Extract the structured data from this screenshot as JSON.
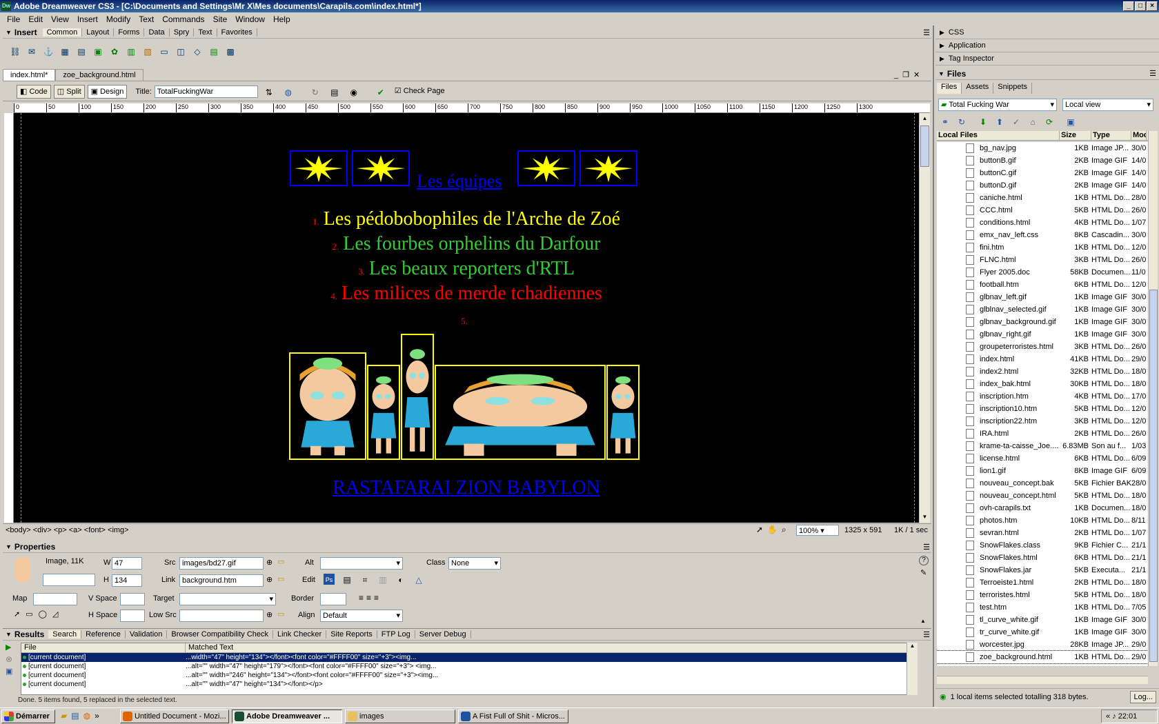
{
  "window": {
    "title": "Adobe Dreamweaver CS3 - [C:\\Documents and Settings\\Mr X\\Mes documents\\Carapils.com\\index.html*]",
    "logo": "Dw"
  },
  "menu": [
    "File",
    "Edit",
    "View",
    "Insert",
    "Modify",
    "Text",
    "Commands",
    "Site",
    "Window",
    "Help"
  ],
  "insert": {
    "title": "Insert",
    "tabs": [
      "Common",
      "Layout",
      "Forms",
      "Data",
      "Spry",
      "Text",
      "Favorites"
    ]
  },
  "doc_tabs": [
    "index.html*",
    "zoe_background.html"
  ],
  "doc_toolbar": {
    "code": "Code",
    "split": "Split",
    "design": "Design",
    "title_label": "Title:",
    "title_value": "TotalFuckingWar",
    "check_page": "Check Page"
  },
  "ruler_ticks": [
    "0",
    "50",
    "100",
    "150",
    "200",
    "250",
    "300",
    "350",
    "400",
    "450",
    "500",
    "550",
    "600",
    "650",
    "700",
    "750",
    "800",
    "850",
    "900",
    "950",
    "1000",
    "1050",
    "1100",
    "1150",
    "1200",
    "1250",
    "1300"
  ],
  "page": {
    "heading_link": "Les équipes",
    "list": [
      {
        "num": "1.",
        "text": "Les pédobobophiles de l'Arche de Zoé",
        "color": "#ffff00"
      },
      {
        "num": "2.",
        "text": "Les fourbes orphelins du Darfour",
        "color": "#33cc33"
      },
      {
        "num": "3.",
        "text": "Les beaux reporters d'RTL",
        "color": "#33cc33"
      },
      {
        "num": "4.",
        "text": "Les milices de merde tchadiennes",
        "color": "#ff0000"
      },
      {
        "num": "5.",
        "text": "",
        "color": "#ff0000"
      }
    ],
    "footer_link": "RASTAFARAI ZION BABYLON"
  },
  "status": {
    "tags": "<body> <div> <p> <a> <font> <img>",
    "zoom": "100%",
    "size": "1325 x 591",
    "download": "1K / 1 sec"
  },
  "properties": {
    "title": "Properties",
    "kind": "Image, 11K",
    "w_label": "W",
    "w": "47",
    "h_label": "H",
    "h": "134",
    "src_label": "Src",
    "src": "images/bd27.gif",
    "link_label": "Link",
    "link": "background.htm",
    "alt_label": "Alt",
    "alt": "",
    "class_label": "Class",
    "class": "None",
    "edit_label": "Edit",
    "map_label": "Map",
    "vspace_label": "V Space",
    "target_label": "Target",
    "border_label": "Border",
    "hspace_label": "H Space",
    "lowsrc_label": "Low Src",
    "align_label": "Align",
    "align": "Default"
  },
  "results": {
    "title": "Results",
    "tabs": [
      "Search",
      "Reference",
      "Validation",
      "Browser Compatibility Check",
      "Link Checker",
      "Site Reports",
      "FTP Log",
      "Server Debug"
    ],
    "col_file": "File",
    "col_match": "Matched Text",
    "rows": [
      {
        "file": "[current document]",
        "match": "...width=\"47\" height=\"134\"></font><font color=\"#FFFF00\" size=\"+3\"><img..."
      },
      {
        "file": "[current document]",
        "match": "...alt=\"\" width=\"47\" height=\"179\"></font><font color=\"#FFFF00\" size=\"+3\"> <img..."
      },
      {
        "file": "[current document]",
        "match": "...alt=\"\" width=\"246\" height=\"134\"></font><font color=\"#FFFF00\" size=\"+3\"><img..."
      },
      {
        "file": "[current document]",
        "match": "...alt=\"\" width=\"47\" height=\"134\"></font></p>"
      }
    ],
    "status": "Done. 5 items found, 5 replaced in the selected text."
  },
  "right_panels": [
    "CSS",
    "Application",
    "Tag Inspector"
  ],
  "files": {
    "title": "Files",
    "tabs": [
      "Files",
      "Assets",
      "Snippets"
    ],
    "site": "Total Fucking War",
    "view": "Local view",
    "cols": [
      "Local Files",
      "Size",
      "Type",
      "Mod"
    ],
    "items": [
      {
        "name": "bg_nav.jpg",
        "size": "1KB",
        "type": "Image JP...",
        "mod": "30/0"
      },
      {
        "name": "buttonB.gif",
        "size": "2KB",
        "type": "Image GIF",
        "mod": "14/0"
      },
      {
        "name": "buttonC.gif",
        "size": "2KB",
        "type": "Image GIF",
        "mod": "14/0"
      },
      {
        "name": "buttonD.gif",
        "size": "2KB",
        "type": "Image GIF",
        "mod": "14/0"
      },
      {
        "name": "caniche.html",
        "size": "1KB",
        "type": "HTML Do...",
        "mod": "28/0"
      },
      {
        "name": "CCC.html",
        "size": "5KB",
        "type": "HTML Do...",
        "mod": "26/0"
      },
      {
        "name": "conditions.html",
        "size": "4KB",
        "type": "HTML Do...",
        "mod": "1/07"
      },
      {
        "name": "emx_nav_left.css",
        "size": "8KB",
        "type": "Cascadin...",
        "mod": "30/0"
      },
      {
        "name": "fini.htm",
        "size": "1KB",
        "type": "HTML Do...",
        "mod": "12/0"
      },
      {
        "name": "FLNC.html",
        "size": "3KB",
        "type": "HTML Do...",
        "mod": "26/0"
      },
      {
        "name": "Flyer 2005.doc",
        "size": "58KB",
        "type": "Documen...",
        "mod": "11/0"
      },
      {
        "name": "football.htm",
        "size": "6KB",
        "type": "HTML Do...",
        "mod": "12/0"
      },
      {
        "name": "glbnav_left.gif",
        "size": "1KB",
        "type": "Image GIF",
        "mod": "30/0"
      },
      {
        "name": "glblnav_selected.gif",
        "size": "1KB",
        "type": "Image GIF",
        "mod": "30/0"
      },
      {
        "name": "glbnav_background.gif",
        "size": "1KB",
        "type": "Image GIF",
        "mod": "30/0"
      },
      {
        "name": "glbnav_right.gif",
        "size": "1KB",
        "type": "Image GIF",
        "mod": "30/0"
      },
      {
        "name": "groupeterroristes.html",
        "size": "3KB",
        "type": "HTML Do...",
        "mod": "26/0"
      },
      {
        "name": "index.html",
        "size": "41KB",
        "type": "HTML Do...",
        "mod": "29/0"
      },
      {
        "name": "index2.html",
        "size": "32KB",
        "type": "HTML Do...",
        "mod": "18/0"
      },
      {
        "name": "index_bak.html",
        "size": "30KB",
        "type": "HTML Do...",
        "mod": "18/0"
      },
      {
        "name": "inscription.htm",
        "size": "4KB",
        "type": "HTML Do...",
        "mod": "17/0"
      },
      {
        "name": "inscription10.htm",
        "size": "5KB",
        "type": "HTML Do...",
        "mod": "12/0"
      },
      {
        "name": "inscription22.htm",
        "size": "3KB",
        "type": "HTML Do...",
        "mod": "12/0"
      },
      {
        "name": "IRA.html",
        "size": "2KB",
        "type": "HTML Do...",
        "mod": "26/0"
      },
      {
        "name": "krame-ta-caisse_Joe....",
        "size": "6.83MB",
        "type": "Son au f...",
        "mod": "1/03"
      },
      {
        "name": "license.html",
        "size": "6KB",
        "type": "HTML Do...",
        "mod": "6/09"
      },
      {
        "name": "lion1.gif",
        "size": "8KB",
        "type": "Image GIF",
        "mod": "6/09"
      },
      {
        "name": "nouveau_concept.bak",
        "size": "5KB",
        "type": "Fichier BAK",
        "mod": "28/0"
      },
      {
        "name": "nouveau_concept.html",
        "size": "5KB",
        "type": "HTML Do...",
        "mod": "18/0"
      },
      {
        "name": "ovh-carapils.txt",
        "size": "1KB",
        "type": "Documen...",
        "mod": "18/0"
      },
      {
        "name": "photos.htm",
        "size": "10KB",
        "type": "HTML Do...",
        "mod": "8/11"
      },
      {
        "name": "sevran.html",
        "size": "2KB",
        "type": "HTML Do...",
        "mod": "1/07"
      },
      {
        "name": "SnowFlakes.class",
        "size": "9KB",
        "type": "Fichier C...",
        "mod": "21/1"
      },
      {
        "name": "SnowFlakes.html",
        "size": "6KB",
        "type": "HTML Do...",
        "mod": "21/1"
      },
      {
        "name": "SnowFlakes.jar",
        "size": "5KB",
        "type": "Executa...",
        "mod": "21/1"
      },
      {
        "name": "Terroeiste1.html",
        "size": "2KB",
        "type": "HTML Do...",
        "mod": "18/0"
      },
      {
        "name": "terroristes.html",
        "size": "5KB",
        "type": "HTML Do...",
        "mod": "18/0"
      },
      {
        "name": "test.htm",
        "size": "1KB",
        "type": "HTML Do...",
        "mod": "7/05"
      },
      {
        "name": "tl_curve_white.gif",
        "size": "1KB",
        "type": "Image GIF",
        "mod": "30/0"
      },
      {
        "name": "tr_curve_white.gif",
        "size": "1KB",
        "type": "Image GIF",
        "mod": "30/0"
      },
      {
        "name": "worcester.jpg",
        "size": "28KB",
        "type": "Image JP...",
        "mod": "29/0"
      },
      {
        "name": "zoe_background.html",
        "size": "1KB",
        "type": "HTML Do...",
        "mod": "29/0"
      }
    ],
    "status": "1 local items selected totalling 318 bytes.",
    "log_button": "Log..."
  },
  "taskbar": {
    "start": "Démarrer",
    "tasks": [
      "Untitled Document - Mozi...",
      "Adobe Dreamweaver ...",
      "images",
      "A Fist Full of Shit - Micros..."
    ],
    "clock": "22:01"
  }
}
